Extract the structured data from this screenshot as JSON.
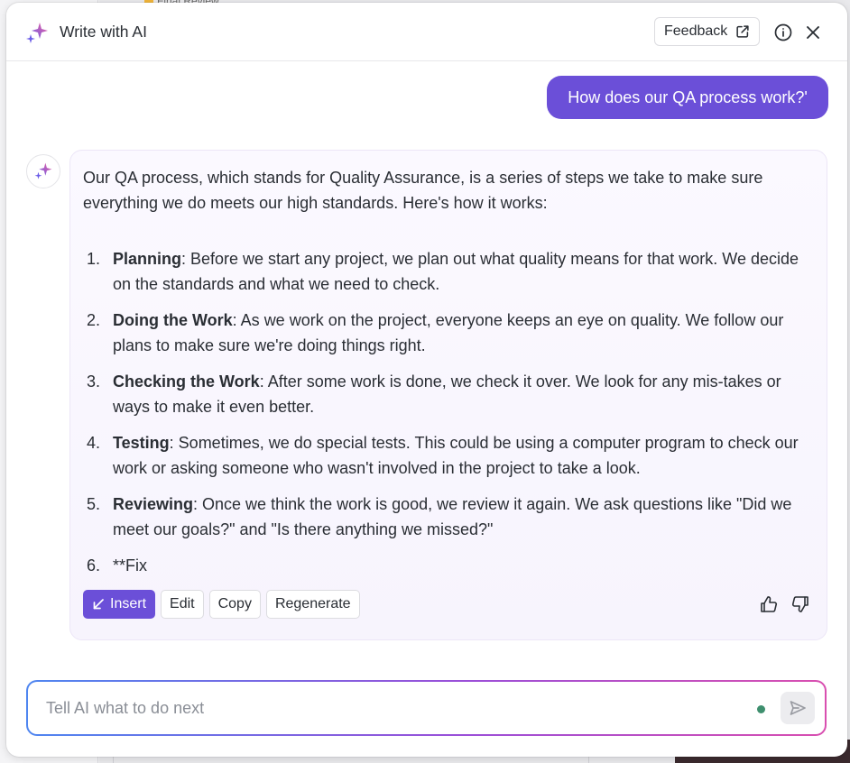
{
  "header": {
    "title": "Write with AI",
    "feedback_label": "Feedback",
    "icons": [
      "sparkle-icon",
      "external-link-icon",
      "info-icon",
      "close-icon"
    ]
  },
  "background": {
    "peek_text": "Final Review"
  },
  "conversation": {
    "user_message": "How does our QA process work?'",
    "ai_intro": "Our QA process, which stands for Quality Assurance, is a series of steps we take to make sure everything we do meets our high standards. Here's how it works:",
    "ai_steps": [
      {
        "num": "1.",
        "title": "Planning",
        "text": ": Before we start any project, we plan out what quality means for that work. We decide on the standards and what we need to check."
      },
      {
        "num": "2.",
        "title": "Doing the Work",
        "text": ": As we work on the project, everyone keeps an eye on quality. We follow our plans to make sure we're doing things right."
      },
      {
        "num": "3.",
        "title": "Checking the Work",
        "text": ": After some work is done, we check it over. We look for any mis-takes or ways to make it even better."
      },
      {
        "num": "4.",
        "title": "Testing",
        "text": ": Sometimes, we do special tests. This could be using a computer program to check our work or asking someone who wasn't involved in the project to take a look."
      },
      {
        "num": "5.",
        "title": "Reviewing",
        "text": ": Once we think the work is good, we review it again. We ask questions like \"Did we meet our goals?\" and \"Is there anything we missed?\""
      },
      {
        "num": "6.",
        "title": "",
        "text": "**Fix"
      }
    ]
  },
  "actions": {
    "insert": "Insert",
    "edit": "Edit",
    "copy": "Copy",
    "regenerate": "Regenerate"
  },
  "composer": {
    "placeholder": "Tell AI what to do next",
    "value": ""
  },
  "colors": {
    "accent": "#6b4fd8",
    "status_dot": "#3e8f6e"
  }
}
